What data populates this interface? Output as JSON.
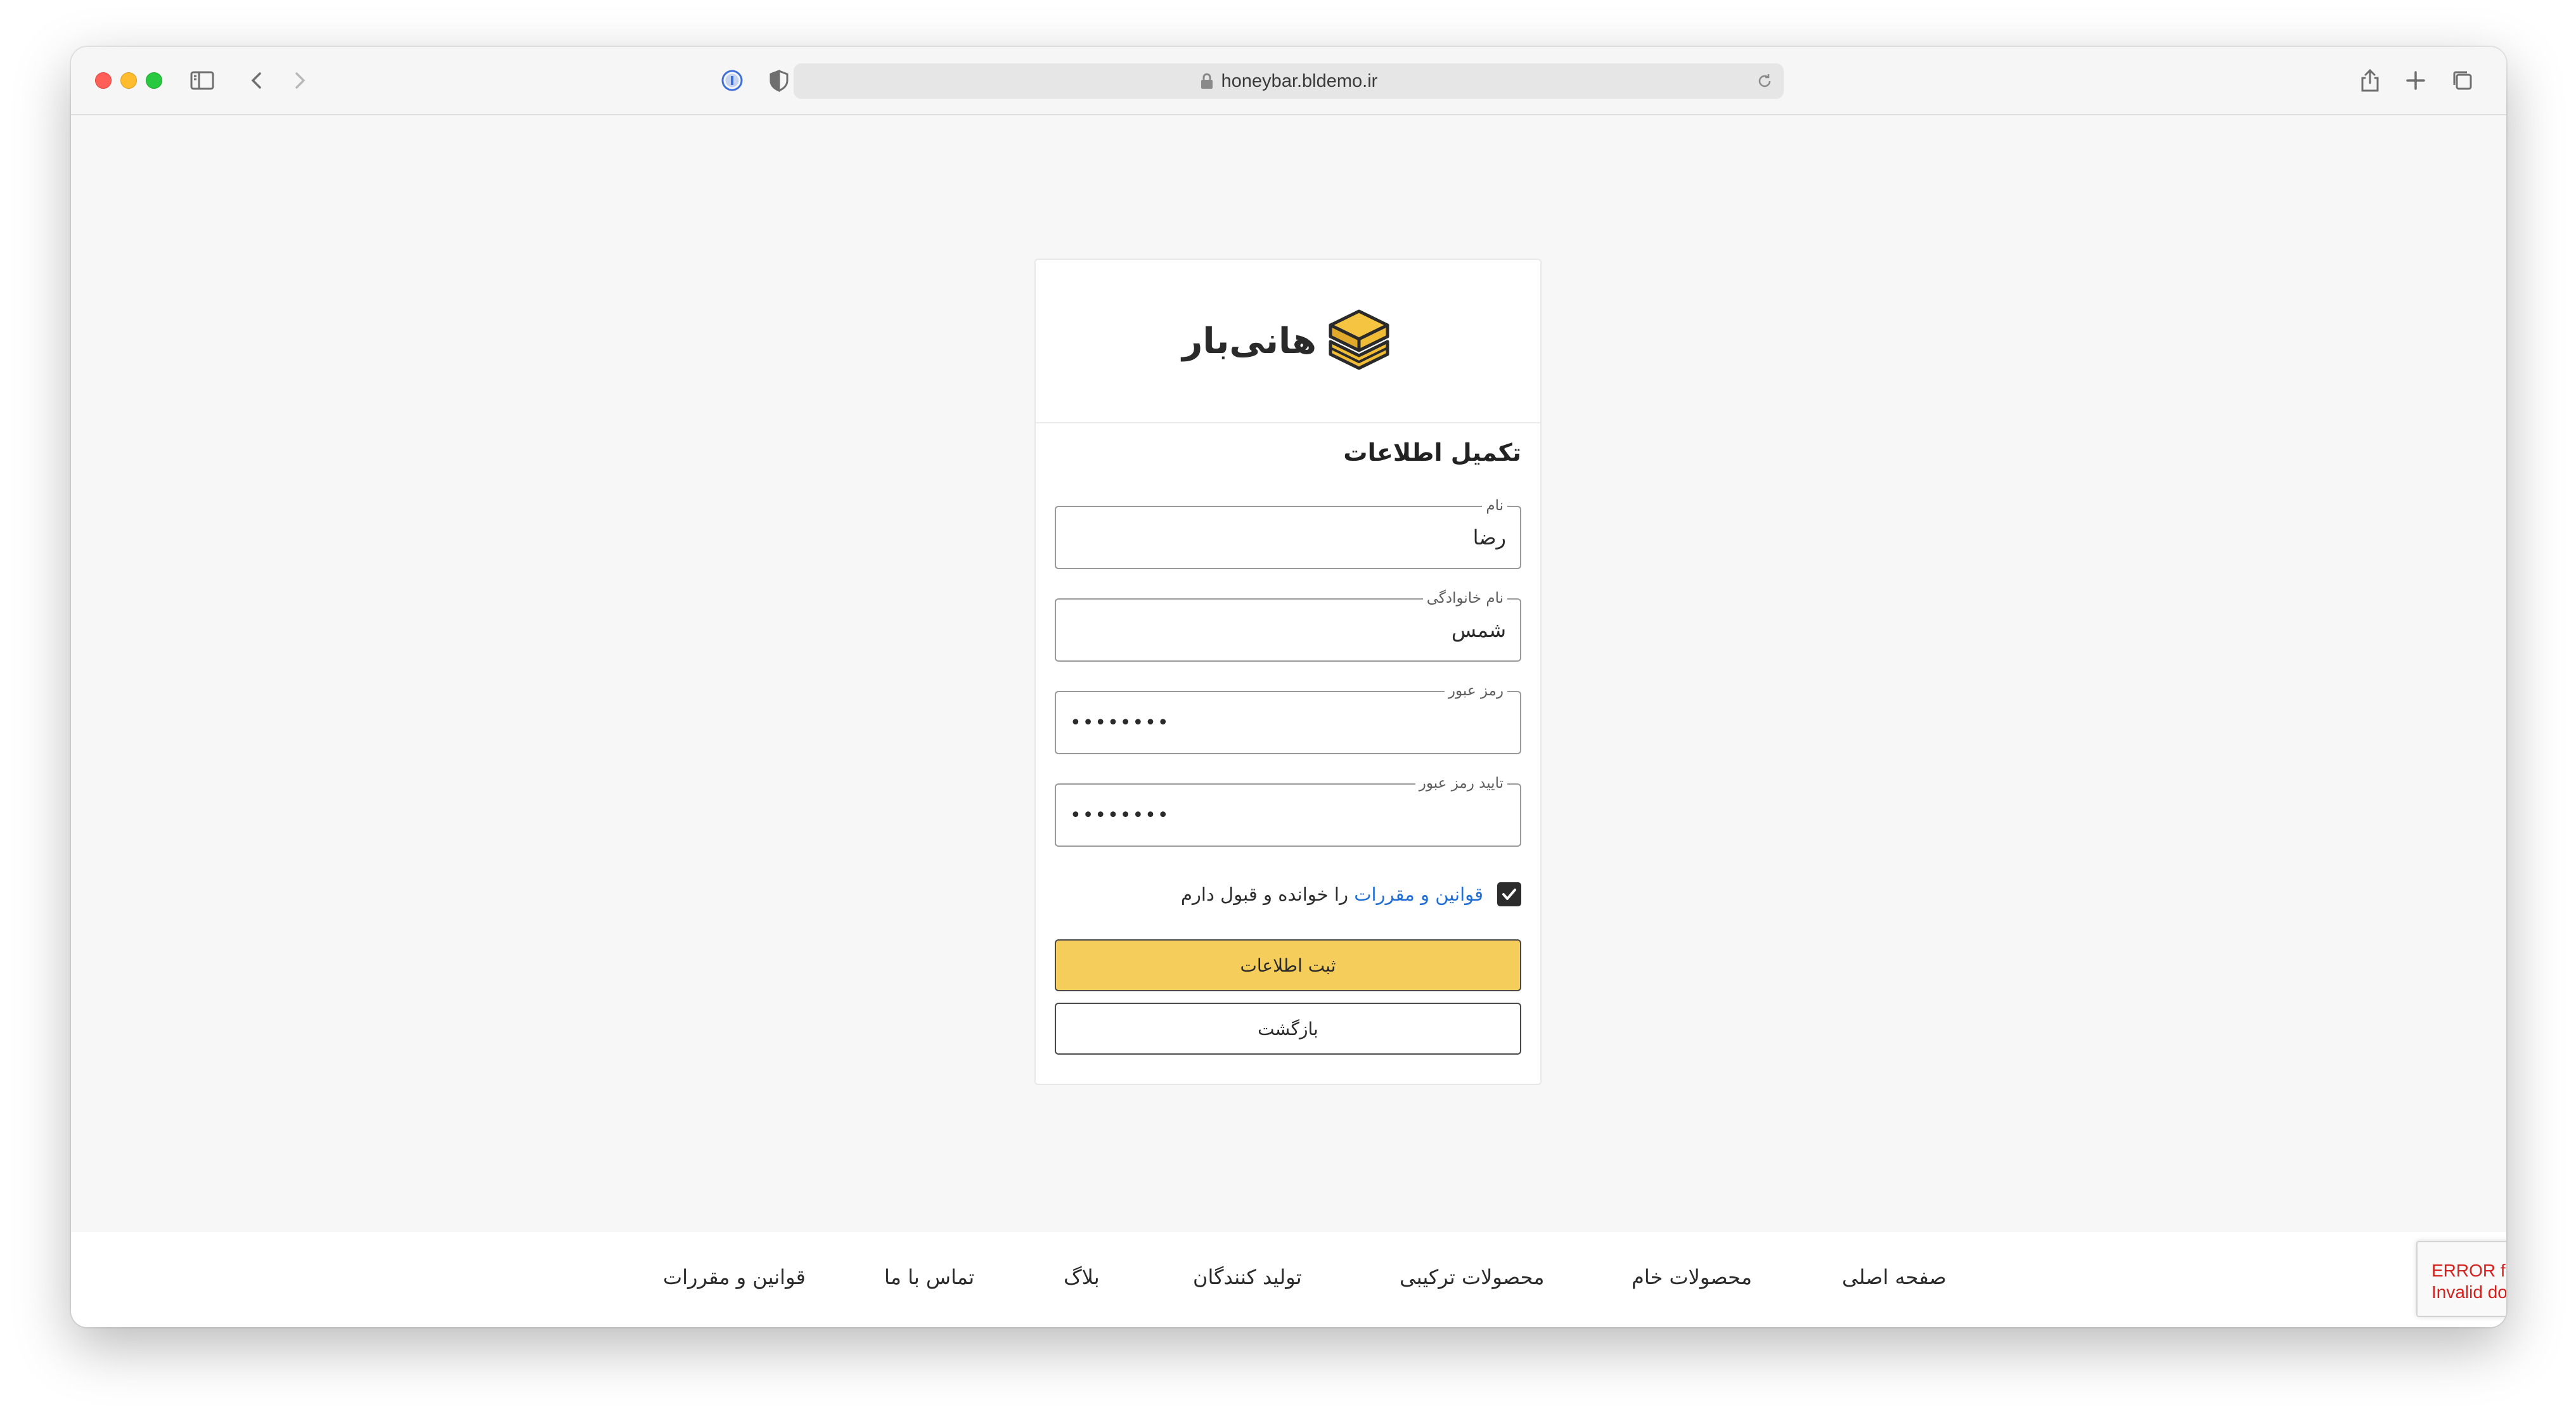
{
  "browser": {
    "url": "honeybar.bldemo.ir"
  },
  "logo": {
    "text": "هانی‌بار"
  },
  "form": {
    "title": "تکمیل اطلاعات",
    "first_name": {
      "label": "نام",
      "value": "رضا"
    },
    "last_name": {
      "label": "نام خانوادگی",
      "value": "شمس"
    },
    "password": {
      "label": "رمز عبور",
      "value": "••••••••"
    },
    "confirm_password": {
      "label": "تایید رمز عبور",
      "value": "••••••••"
    },
    "terms": {
      "checked": true,
      "link_text": "قوانین و مقررات",
      "suffix_text": " را خوانده و قبول دارم"
    },
    "submit_label": "ثبت اطلاعات",
    "back_label": "بازگشت"
  },
  "footer": {
    "items": [
      "صفحه اصلی",
      "محصولات خام",
      "محصولات ترکیبی",
      "تولید کنندگان",
      "بلاگ",
      "تماس با ما",
      "قوانین و مقررات"
    ]
  },
  "recaptcha": {
    "line1": "ERROR fo",
    "line2": "Invalid do"
  },
  "colors": {
    "accent": "#f5cd5b",
    "link": "#1f6fd6",
    "error": "#d4231e"
  }
}
